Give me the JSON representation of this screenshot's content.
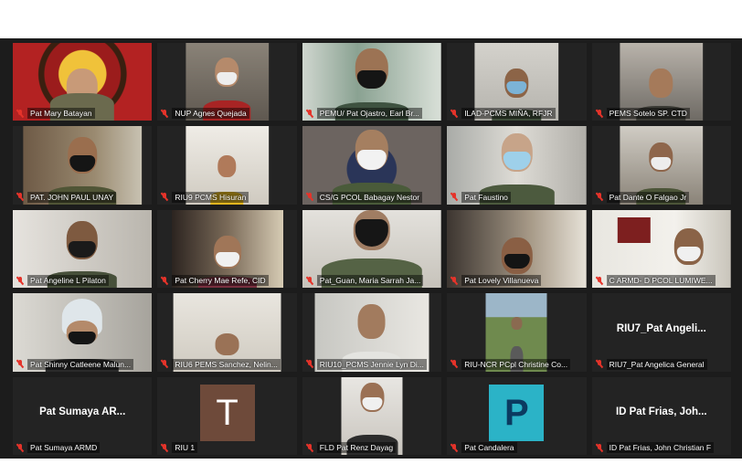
{
  "participants": [
    {
      "name": "Pat Mary Batayan"
    },
    {
      "name": "NUP Agnes Quejada"
    },
    {
      "name": "PEMU/ Pat Ojastro, Earl Br..."
    },
    {
      "name": "ILAD-PCMS MIÑA, RFJR"
    },
    {
      "name": "PEMS Sotelo SP. CTD"
    },
    {
      "name": "PAT. JOHN PAUL UNAY"
    },
    {
      "name": "RIU9 PCMS Hisuran"
    },
    {
      "name": "CS/G PCOL Babagay Nestor"
    },
    {
      "name": "Pat Faustino"
    },
    {
      "name": "Pat Dante O Falgao Jr"
    },
    {
      "name": "Pat Angeline L Pilaton"
    },
    {
      "name": "Pat Cherry Mae Refe, CID"
    },
    {
      "name": "Pat_Guan, Maria Sarrah Ja..."
    },
    {
      "name": "Pat Lovely Villanueva"
    },
    {
      "name": "C ARMD- D PCOL LUMIWE..."
    },
    {
      "name": "Pat Shinny Catleene Malun..."
    },
    {
      "name": "RIU6 PEMS Sanchez, Nelin..."
    },
    {
      "name": "RIU10_PCMS Jennie Lyn Di..."
    },
    {
      "name": "RIU-NCR PCpl Christine Co..."
    },
    {
      "name": "RIU7_Pat Angelica General",
      "display": "RIU7_Pat Angeli..."
    },
    {
      "name": "Pat Sumaya ARMD",
      "display": "Pat Sumaya AR..."
    },
    {
      "name": "RIU 1",
      "avatar_letter": "T",
      "avatar_color": "#6e4a3a"
    },
    {
      "name": "FLD Pat Renz Dayag"
    },
    {
      "name": "Pat Candalera",
      "avatar_letter": "P",
      "avatar_color": "#2bb3c7"
    },
    {
      "name": "ID Pat Frias, John Christian F",
      "display": "ID Pat Frias, Joh..."
    }
  ],
  "colors": {
    "background": "#1c1c1c",
    "muted_mic": "#e5332a"
  }
}
